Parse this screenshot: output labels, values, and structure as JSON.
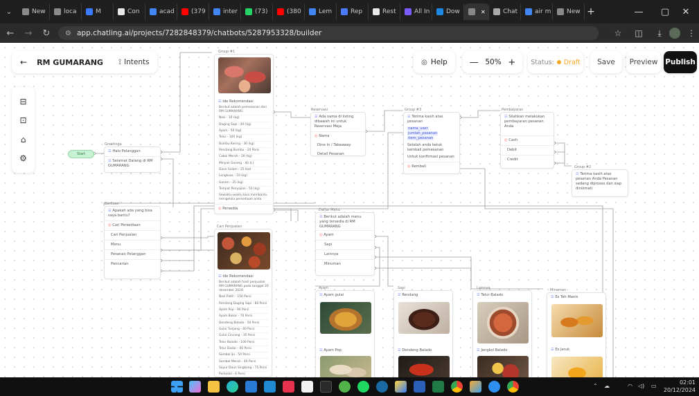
{
  "browser": {
    "tabs": [
      {
        "label": "New",
        "color": "#8a8a8a"
      },
      {
        "label": "loca",
        "color": "#8a8a8a"
      },
      {
        "label": "M",
        "color": "#3b7bff"
      },
      {
        "label": "Con",
        "color": "#e8e8e8"
      },
      {
        "label": "acad",
        "color": "#4285f4"
      },
      {
        "label": "(379",
        "color": "#ff0000"
      },
      {
        "label": "inter",
        "color": "#4285f4"
      },
      {
        "label": "(73)",
        "color": "#25d366"
      },
      {
        "label": "(380",
        "color": "#ff0000"
      },
      {
        "label": "Lem",
        "color": "#4285f4"
      },
      {
        "label": "Rep",
        "color": "#4a7cf7"
      },
      {
        "label": "Rest",
        "color": "#e8e8e8"
      },
      {
        "label": "All In",
        "color": "#7b5cff"
      },
      {
        "label": "Dow",
        "color": "#1e88e5"
      },
      {
        "label": "",
        "color": "#888888"
      },
      {
        "label": "Chat",
        "color": "#aaaaaa"
      },
      {
        "label": "air m",
        "color": "#4285f4"
      },
      {
        "label": "New",
        "color": "#8a8a8a"
      }
    ],
    "url": "app.chatling.ai/projects/7282848379/chatbots/5287953328/builder"
  },
  "toolbar": {
    "project_name": "RM GUMARANG",
    "intents_label": "Intents",
    "help_label": "Help",
    "zoom": "50%",
    "status_label": "Status:",
    "status_value": "Draft",
    "save_label": "Save",
    "preview_label": "Preview",
    "publish_label": "Publish"
  },
  "nodes": {
    "start": "Start",
    "greetings": {
      "title": "Greetings",
      "rows": [
        "Halo Pelanggan",
        "Selamat Datang di RM GUMARANG"
      ]
    },
    "group1": {
      "title": "Group #1",
      "intro": "Ide Rekomendasi",
      "rows": [
        "Berikut adalah pemesanan dari RM GUMARANG:",
        "Nasi - 10 (kg)",
        "Daging Sapi - 40 (kg)",
        "Ayam - 50 (kg)",
        "Telur - 100 (kg)",
        "Bumbu Kering - 30 (kg)",
        "Rendang Bumbu - 20 Porsi",
        "Cabai Merah - 20 (kg)",
        "Minyak Goreng - 40 (L)",
        "Daun Salam - 25 Ikat",
        "Lengkuas - 10 (kg)",
        "Garam - 25 (kg)",
        "Tempat Penyajian - 50 (kg)",
        "Sewaktu-waktu bisa membantu mengelola persediaan anda"
      ],
      "footer": "Persedia"
    },
    "bantuan": {
      "title": "Bantuan",
      "rows": [
        "Apakah ada yang bisa saya bantu?",
        "Cari Persediaan",
        "Cari Penjualan",
        "Menu",
        "Pesanan Pelanggan",
        "Pencarian"
      ]
    },
    "cari_penjualan": {
      "title": "Cari Penjualan",
      "intro": "Ide Rekomendasi",
      "rows": [
        "Berikut adalah hasil penjualan RM GUMARANG pada tanggal 20 desember 2024:",
        "Nasi Putih - 150 Porsi",
        "Rendang Daging Sapi - 80 Porsi",
        "Ayam Pop - 90 Porsi",
        "Ayam Bakar - 70 Porsi",
        "Dendeng Balado - 50 Porsi",
        "Gulai Tunjang - 40 Porsi",
        "Gulai Cincang - 35 Porsi",
        "Telur Balado - 100 Porsi",
        "Telur Dadar - 60 Porsi",
        "Sambal Ijo - 50 Porsi",
        "Sambal Merah - 40 Porsi",
        "Sayur Daun Singkong - 75 Porsi",
        "Perkedel - 6 Porsi"
      ]
    },
    "reservasi": {
      "title": "Reservasi",
      "rows": [
        "Ada nama di listing dibawah ini untuk Reservasi Meja",
        "Nama",
        "Dine in / Takeaway",
        "Detail Pesanan"
      ]
    },
    "group3": {
      "title": "Group #3",
      "rows": [
        "Terima kasih atas pesanan",
        "nama_user",
        "jumlah_pesanan",
        "item_pesanan",
        "Setelah anda ketuk kembali pemesanan",
        "Untuk konfirmasi pesanan",
        "Kembali"
      ]
    },
    "pembayaran": {
      "title": "Pembayaran",
      "rows": [
        "Silahkan melakukan pembayaran pesanan Anda",
        "Cash",
        "Debit",
        "Credit"
      ]
    },
    "group2": {
      "title": "Group #2",
      "rows": [
        "Terima kasih atas pesanan Anda",
        "Pesanan sedang diproses dan siap dinikmati"
      ]
    },
    "daftar_menu": {
      "title": "Daftar Menu",
      "rows": [
        "Berikut adalah menu yang tersedia di RM GUMARANG",
        "Ayam",
        "Sapi",
        "Lainnya",
        "Minuman"
      ]
    },
    "ayam": {
      "title": "Ayam",
      "items": [
        "Ayam gulai",
        "Ayam Pop"
      ]
    },
    "sapi": {
      "title": "Sapi",
      "items": [
        "Rendang",
        "Dendeng Balado"
      ]
    },
    "lainnya": {
      "title": "Lainnya",
      "items": [
        "Telur Balado",
        "Jengkol Balado"
      ]
    },
    "minuman": {
      "title": "Minuman",
      "items": [
        "Es Teh Manis",
        "Es Jeruk"
      ]
    }
  },
  "taskbar": {
    "time": "02:01",
    "date": "20/12/2024"
  }
}
